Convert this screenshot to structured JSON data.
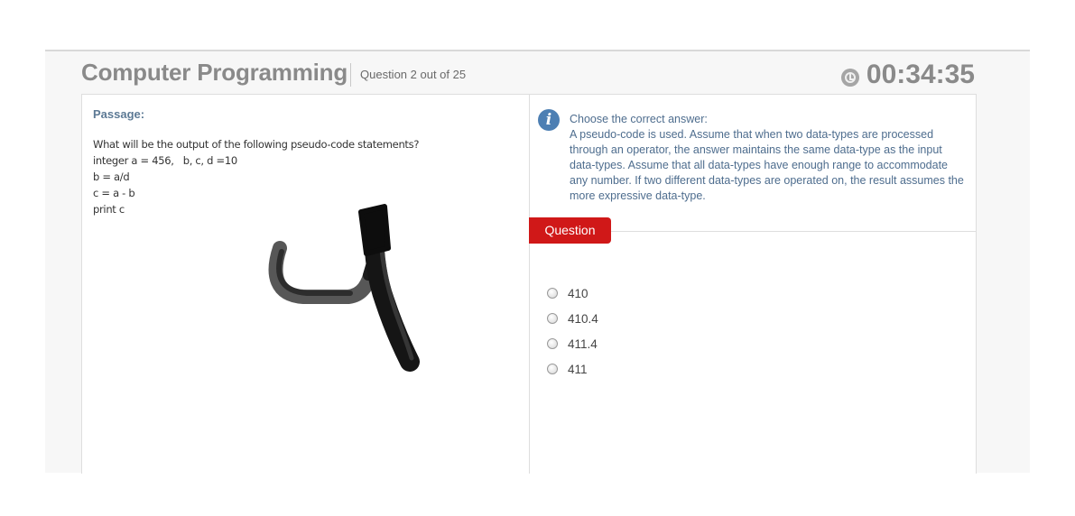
{
  "header": {
    "title": "Computer Programming",
    "question_counter": "Question 2 out of 25",
    "timer": "00:34:35",
    "timer_icon": "clock-icon"
  },
  "passage": {
    "label": "Passage:",
    "lines": [
      "What will be the output of the following pseudo-code statements?",
      "integer a = 456,   b, c, d =10",
      "b = a/d",
      "c = a - b",
      "print c"
    ]
  },
  "instructions": {
    "icon": "info-icon",
    "icon_glyph": "i",
    "heading": "Choose the correct answer:",
    "text": "A pseudo-code is used. Assume that when two data-types are processed through an operator, the answer maintains the same data-type as the input data-types. Assume that all data-types have enough range to accommodate any number. If two different data-types are operated on, the result assumes the more expressive data-type."
  },
  "question_tab": {
    "label": "Question"
  },
  "options": [
    {
      "label": "410",
      "selected": false
    },
    {
      "label": "410.4",
      "selected": false
    },
    {
      "label": "411.4",
      "selected": false
    },
    {
      "label": "411",
      "selected": false
    }
  ],
  "colors": {
    "accent_red": "#d01818",
    "info_blue": "#4d7fb3",
    "header_gray": "#8a8a8a",
    "passage_label": "#5d7a95"
  }
}
